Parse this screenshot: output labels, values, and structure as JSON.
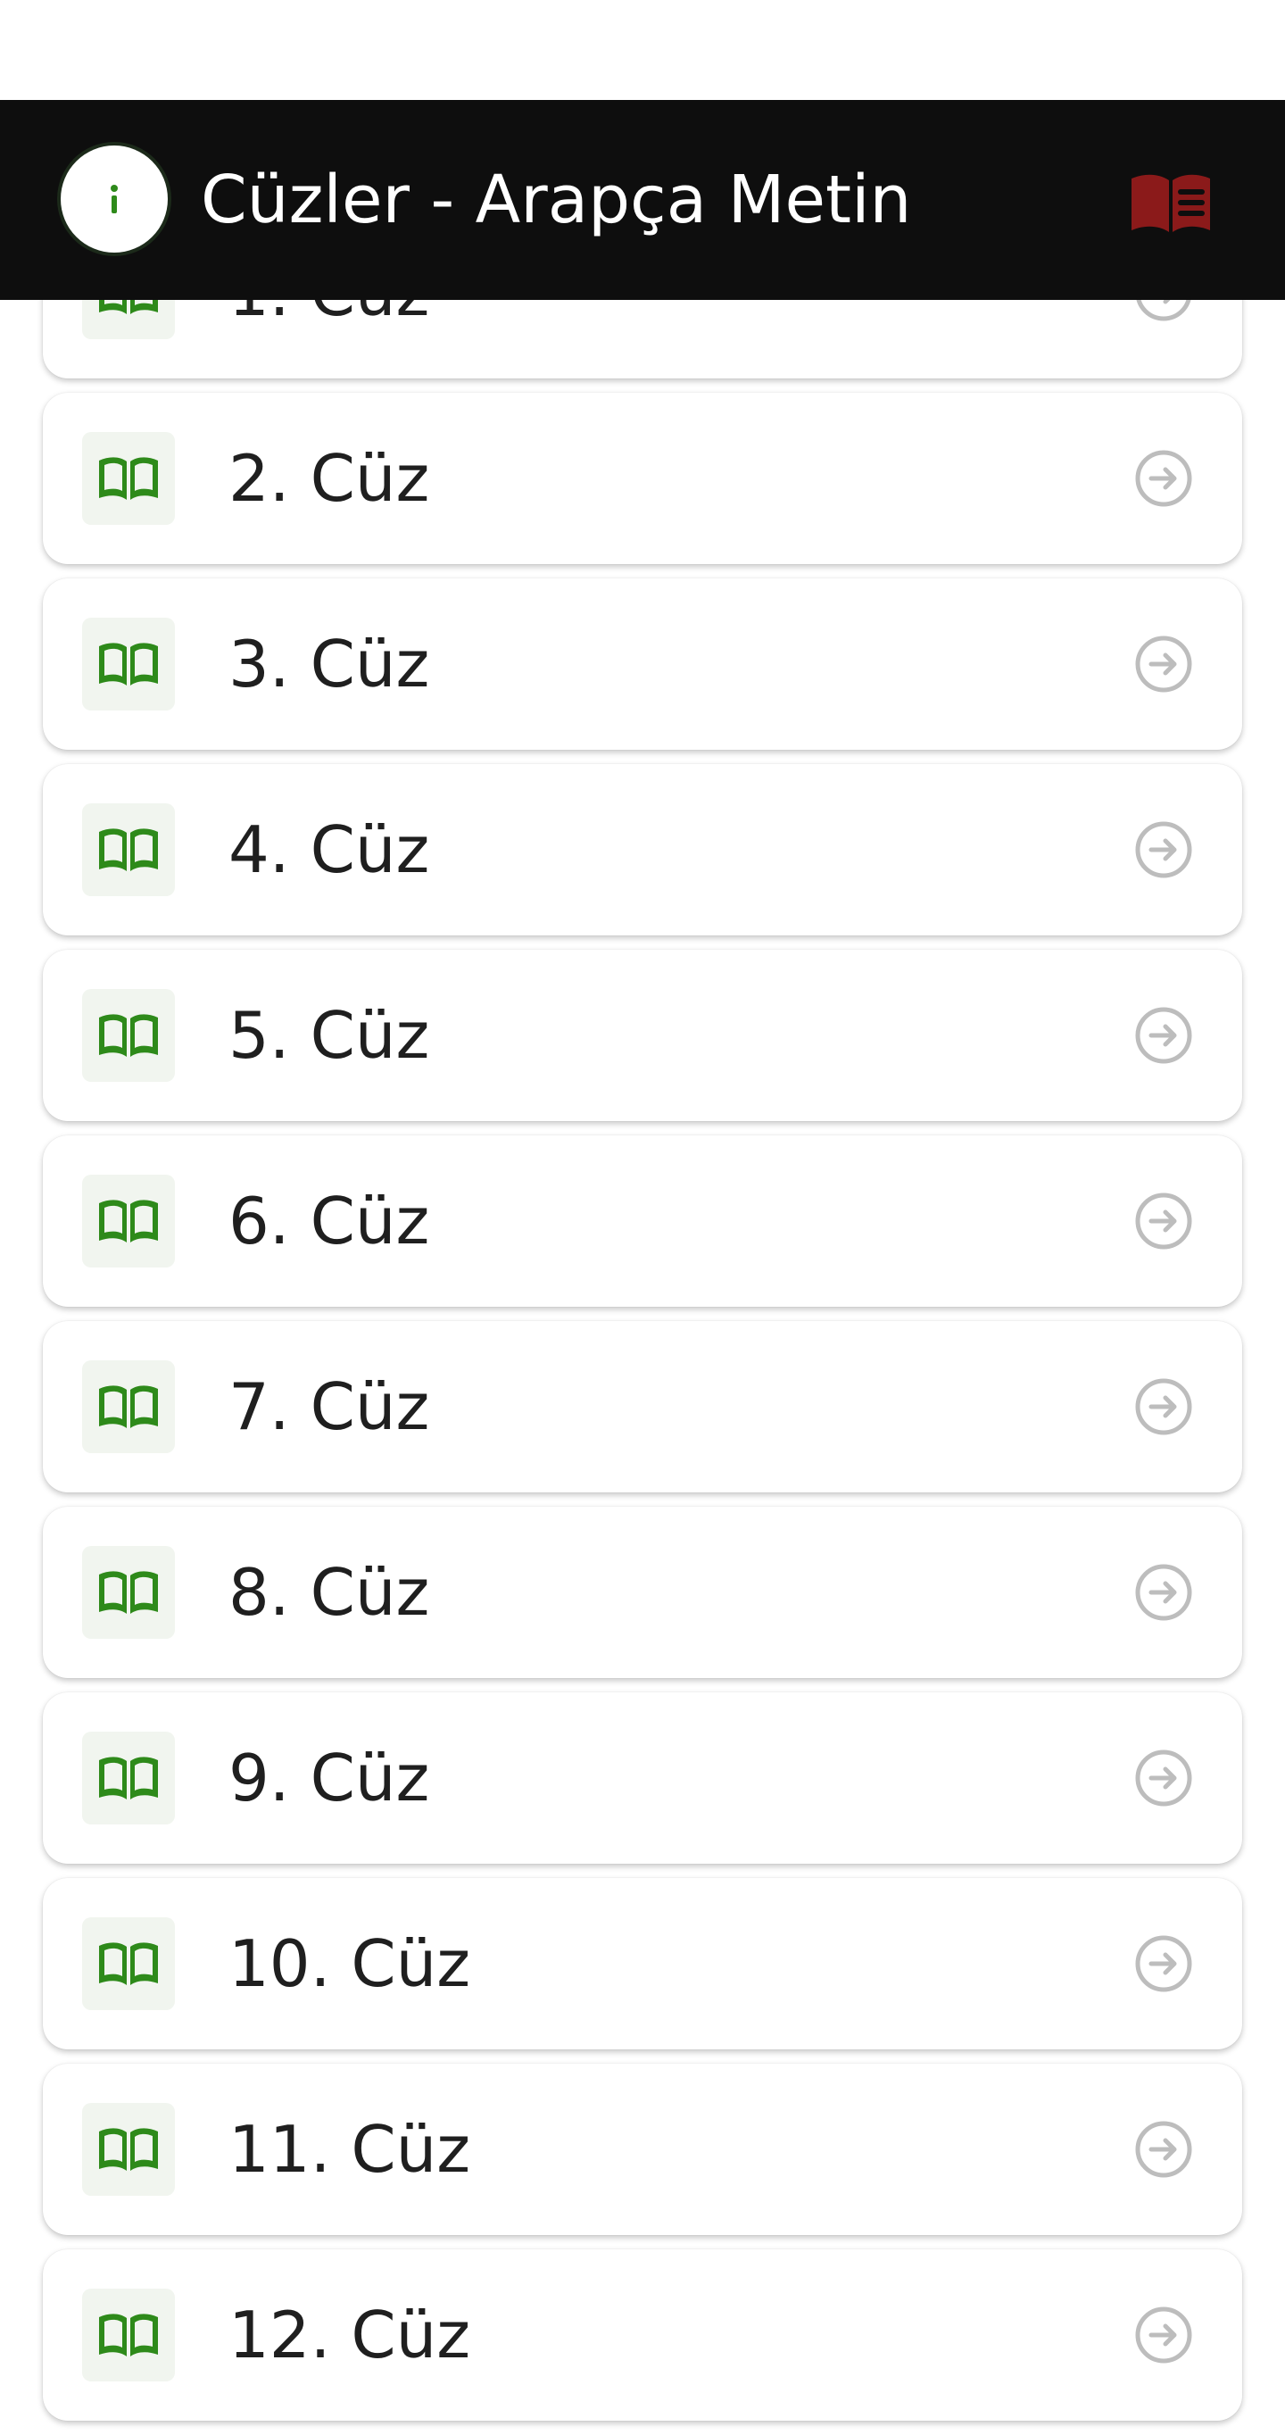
{
  "header": {
    "title": "Cüzler - Arapça Metin",
    "info_icon": "info-icon",
    "book_icon": "book-list-icon",
    "colors": {
      "bar_background": "#0e0e0e",
      "title": "#ffffff",
      "book_icon": "#8b1a1a"
    }
  },
  "list": {
    "item_icon": "open-book-icon",
    "arrow_icon": "arrow-circle-right-icon",
    "colors": {
      "book_icon": "#2e8a1a",
      "icon_background": "#f1f5ef",
      "arrow": "#bdbdbd",
      "label": "#1f1f1f"
    },
    "items": [
      {
        "label": "1. Cüz"
      },
      {
        "label": "2. Cüz"
      },
      {
        "label": "3. Cüz"
      },
      {
        "label": "4. Cüz"
      },
      {
        "label": "5. Cüz"
      },
      {
        "label": "6. Cüz"
      },
      {
        "label": "7. Cüz"
      },
      {
        "label": "8. Cüz"
      },
      {
        "label": "9. Cüz"
      },
      {
        "label": "10. Cüz"
      },
      {
        "label": "11. Cüz"
      },
      {
        "label": "12. Cüz"
      }
    ]
  }
}
